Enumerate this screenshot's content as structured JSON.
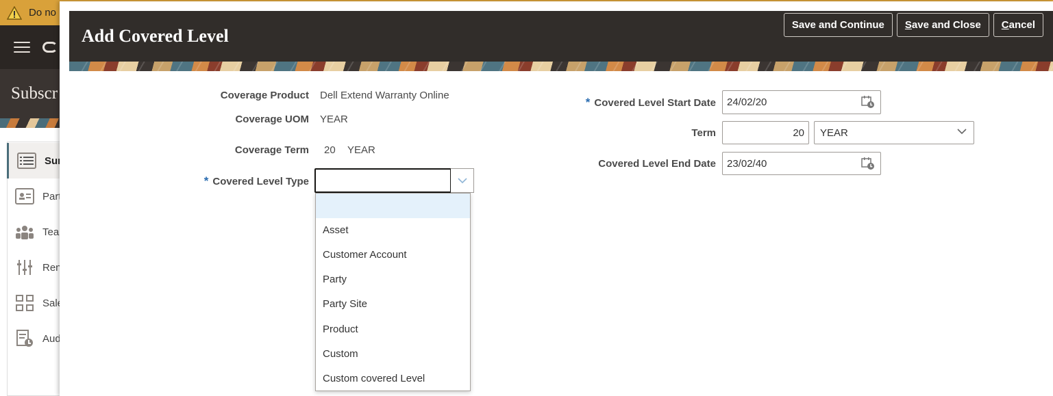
{
  "background": {
    "warning_text": "Do no",
    "page_title": "Subscr",
    "nav": [
      {
        "label": "Sur",
        "icon": "list-icon"
      },
      {
        "label": "Part",
        "icon": "id-card-icon"
      },
      {
        "label": "Tea",
        "icon": "team-icon"
      },
      {
        "label": "Ren",
        "icon": "sliders-icon"
      },
      {
        "label": "Sale",
        "icon": "grid-icon"
      },
      {
        "label": "Aud",
        "icon": "document-clock-icon"
      }
    ]
  },
  "modal": {
    "title": "Add Covered Level",
    "buttons": {
      "save_continue": "Save and Continue",
      "save_close_u": "S",
      "save_close_rest": "ave and Close",
      "cancel_u": "C",
      "cancel_rest": "ancel"
    }
  },
  "form": {
    "coverage_product": {
      "label": "Coverage Product",
      "value": "Dell Extend Warranty Online"
    },
    "coverage_uom": {
      "label": "Coverage UOM",
      "value": "YEAR"
    },
    "coverage_term": {
      "label": "Coverage Term",
      "value": "20",
      "unit": "YEAR"
    },
    "covered_level_type": {
      "required_mark": "*",
      "label": "Covered Level Type",
      "value": "",
      "options": [
        "",
        "Asset",
        "Customer Account",
        "Party",
        "Party Site",
        "Product",
        "Custom",
        "Custom covered Level"
      ]
    },
    "start_date": {
      "required_mark": "*",
      "label": "Covered Level Start Date",
      "value": "24/02/20"
    },
    "term": {
      "label": "Term",
      "value": "20",
      "unit": "YEAR"
    },
    "end_date": {
      "label": "Covered Level End Date",
      "value": "23/02/40"
    }
  },
  "colors": {
    "header_bg": "#312d2a",
    "required": "#2a6cb0",
    "warning": "#d9a13a",
    "highlight": "#e4f1fb"
  }
}
